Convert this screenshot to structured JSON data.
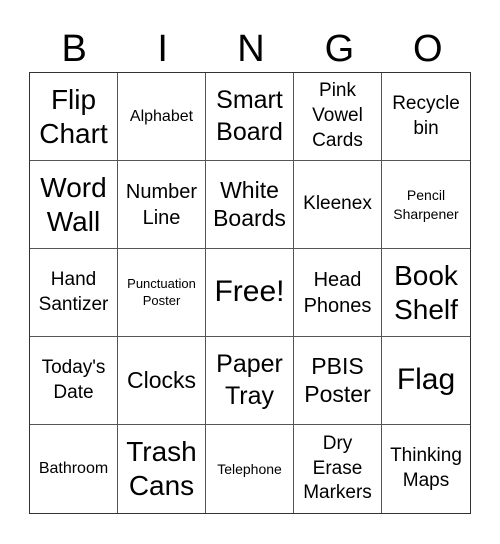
{
  "header": {
    "letters": [
      "B",
      "I",
      "N",
      "G",
      "O"
    ]
  },
  "cells": [
    "Flip Chart",
    "Alphabet",
    "Smart Board",
    "Pink Vowel Cards",
    "Recycle bin",
    "Word Wall",
    "Number Line",
    "White Boards",
    "Kleenex",
    "Pencil Sharpener",
    "Hand Santizer",
    "Punctuation Poster",
    "Free!",
    "Head Phones",
    "Book Shelf",
    "Today's Date",
    "Clocks",
    "Paper Tray",
    "PBIS Poster",
    "Flag",
    "Bathroom",
    "Trash Cans",
    "Telephone",
    "Dry Erase Markers",
    "Thinking Maps"
  ]
}
